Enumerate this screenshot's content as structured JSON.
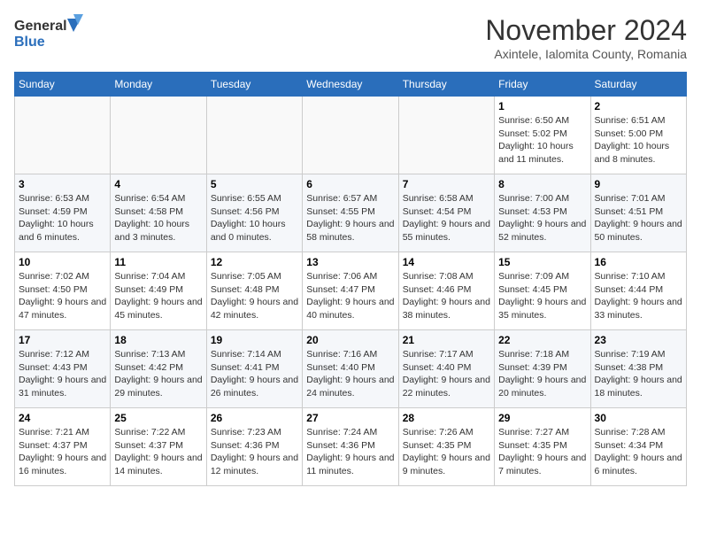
{
  "header": {
    "logo_general": "General",
    "logo_blue": "Blue",
    "month_title": "November 2024",
    "location": "Axintele, Ialomita County, Romania"
  },
  "weekdays": [
    "Sunday",
    "Monday",
    "Tuesday",
    "Wednesday",
    "Thursday",
    "Friday",
    "Saturday"
  ],
  "weeks": [
    [
      {
        "day": "",
        "info": ""
      },
      {
        "day": "",
        "info": ""
      },
      {
        "day": "",
        "info": ""
      },
      {
        "day": "",
        "info": ""
      },
      {
        "day": "",
        "info": ""
      },
      {
        "day": "1",
        "info": "Sunrise: 6:50 AM\nSunset: 5:02 PM\nDaylight: 10 hours and 11 minutes."
      },
      {
        "day": "2",
        "info": "Sunrise: 6:51 AM\nSunset: 5:00 PM\nDaylight: 10 hours and 8 minutes."
      }
    ],
    [
      {
        "day": "3",
        "info": "Sunrise: 6:53 AM\nSunset: 4:59 PM\nDaylight: 10 hours and 6 minutes."
      },
      {
        "day": "4",
        "info": "Sunrise: 6:54 AM\nSunset: 4:58 PM\nDaylight: 10 hours and 3 minutes."
      },
      {
        "day": "5",
        "info": "Sunrise: 6:55 AM\nSunset: 4:56 PM\nDaylight: 10 hours and 0 minutes."
      },
      {
        "day": "6",
        "info": "Sunrise: 6:57 AM\nSunset: 4:55 PM\nDaylight: 9 hours and 58 minutes."
      },
      {
        "day": "7",
        "info": "Sunrise: 6:58 AM\nSunset: 4:54 PM\nDaylight: 9 hours and 55 minutes."
      },
      {
        "day": "8",
        "info": "Sunrise: 7:00 AM\nSunset: 4:53 PM\nDaylight: 9 hours and 52 minutes."
      },
      {
        "day": "9",
        "info": "Sunrise: 7:01 AM\nSunset: 4:51 PM\nDaylight: 9 hours and 50 minutes."
      }
    ],
    [
      {
        "day": "10",
        "info": "Sunrise: 7:02 AM\nSunset: 4:50 PM\nDaylight: 9 hours and 47 minutes."
      },
      {
        "day": "11",
        "info": "Sunrise: 7:04 AM\nSunset: 4:49 PM\nDaylight: 9 hours and 45 minutes."
      },
      {
        "day": "12",
        "info": "Sunrise: 7:05 AM\nSunset: 4:48 PM\nDaylight: 9 hours and 42 minutes."
      },
      {
        "day": "13",
        "info": "Sunrise: 7:06 AM\nSunset: 4:47 PM\nDaylight: 9 hours and 40 minutes."
      },
      {
        "day": "14",
        "info": "Sunrise: 7:08 AM\nSunset: 4:46 PM\nDaylight: 9 hours and 38 minutes."
      },
      {
        "day": "15",
        "info": "Sunrise: 7:09 AM\nSunset: 4:45 PM\nDaylight: 9 hours and 35 minutes."
      },
      {
        "day": "16",
        "info": "Sunrise: 7:10 AM\nSunset: 4:44 PM\nDaylight: 9 hours and 33 minutes."
      }
    ],
    [
      {
        "day": "17",
        "info": "Sunrise: 7:12 AM\nSunset: 4:43 PM\nDaylight: 9 hours and 31 minutes."
      },
      {
        "day": "18",
        "info": "Sunrise: 7:13 AM\nSunset: 4:42 PM\nDaylight: 9 hours and 29 minutes."
      },
      {
        "day": "19",
        "info": "Sunrise: 7:14 AM\nSunset: 4:41 PM\nDaylight: 9 hours and 26 minutes."
      },
      {
        "day": "20",
        "info": "Sunrise: 7:16 AM\nSunset: 4:40 PM\nDaylight: 9 hours and 24 minutes."
      },
      {
        "day": "21",
        "info": "Sunrise: 7:17 AM\nSunset: 4:40 PM\nDaylight: 9 hours and 22 minutes."
      },
      {
        "day": "22",
        "info": "Sunrise: 7:18 AM\nSunset: 4:39 PM\nDaylight: 9 hours and 20 minutes."
      },
      {
        "day": "23",
        "info": "Sunrise: 7:19 AM\nSunset: 4:38 PM\nDaylight: 9 hours and 18 minutes."
      }
    ],
    [
      {
        "day": "24",
        "info": "Sunrise: 7:21 AM\nSunset: 4:37 PM\nDaylight: 9 hours and 16 minutes."
      },
      {
        "day": "25",
        "info": "Sunrise: 7:22 AM\nSunset: 4:37 PM\nDaylight: 9 hours and 14 minutes."
      },
      {
        "day": "26",
        "info": "Sunrise: 7:23 AM\nSunset: 4:36 PM\nDaylight: 9 hours and 12 minutes."
      },
      {
        "day": "27",
        "info": "Sunrise: 7:24 AM\nSunset: 4:36 PM\nDaylight: 9 hours and 11 minutes."
      },
      {
        "day": "28",
        "info": "Sunrise: 7:26 AM\nSunset: 4:35 PM\nDaylight: 9 hours and 9 minutes."
      },
      {
        "day": "29",
        "info": "Sunrise: 7:27 AM\nSunset: 4:35 PM\nDaylight: 9 hours and 7 minutes."
      },
      {
        "day": "30",
        "info": "Sunrise: 7:28 AM\nSunset: 4:34 PM\nDaylight: 9 hours and 6 minutes."
      }
    ]
  ]
}
